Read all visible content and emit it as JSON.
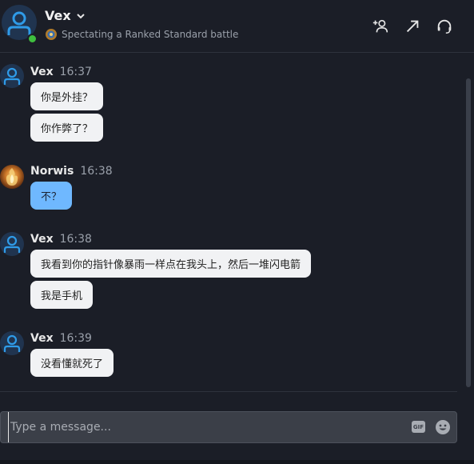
{
  "header": {
    "name": "Vex",
    "status": "Spectating a Ranked Standard battle",
    "online_color": "#3fbf3f",
    "actions": [
      {
        "name": "add-friend-icon"
      },
      {
        "name": "popout-icon"
      },
      {
        "name": "headset-icon"
      }
    ]
  },
  "messages": [
    {
      "sender": "Vex",
      "time": "16:37",
      "bubbles": [
        "你是外挂？",
        "你作弊了？"
      ]
    },
    {
      "sender": "Norwis",
      "time": "16:38",
      "bubbles": [
        "不？"
      ]
    },
    {
      "sender": "Vex",
      "time": "16:38",
      "bubbles": [
        "我看到你的指针像暴雨一样点在我头上，然后一堆闪电箭",
        "我是手机"
      ]
    },
    {
      "sender": "Vex",
      "time": "16:39",
      "bubbles": [
        "没看懂就死了"
      ]
    }
  ],
  "composer": {
    "placeholder": "Type a message...",
    "gif_label": "GIF"
  },
  "colors": {
    "background": "#1b1e27",
    "bubble": "#f1f2f4",
    "own_bubble": "#6fb8ff",
    "accent": "#2f9be8"
  }
}
